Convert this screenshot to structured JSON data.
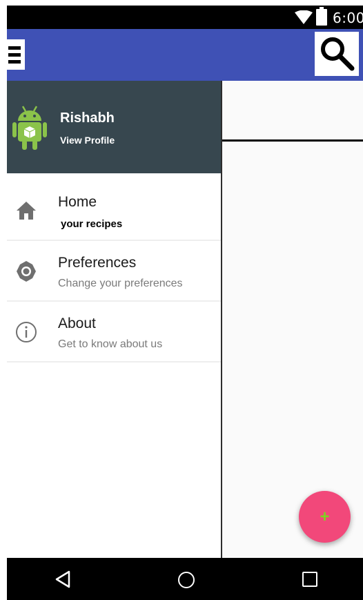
{
  "status_bar": {
    "time": "6:00",
    "icons": [
      "wifi-icon",
      "battery-icon"
    ]
  },
  "app_bar": {
    "menu_icon": "hamburger-menu-icon",
    "search_icon": "search-icon",
    "color": "#3f51b5"
  },
  "drawer": {
    "header": {
      "avatar_icon": "android-robot-icon",
      "name": "Rishabh",
      "subtitle": "View Profile",
      "color": "#37474f"
    },
    "items": [
      {
        "icon": "home-icon",
        "title": "Home",
        "subtitle": "your recipes"
      },
      {
        "icon": "gear-icon",
        "title": "Preferences",
        "subtitle": "Change your preferences"
      },
      {
        "icon": "info-icon",
        "title": "About",
        "subtitle": "Get to know about us"
      }
    ]
  },
  "fab": {
    "label": "+",
    "icon": "add-icon",
    "color": "#f2487a"
  },
  "nav_bar": {
    "icons": [
      "back-icon",
      "home-circle-icon",
      "recents-icon"
    ]
  }
}
